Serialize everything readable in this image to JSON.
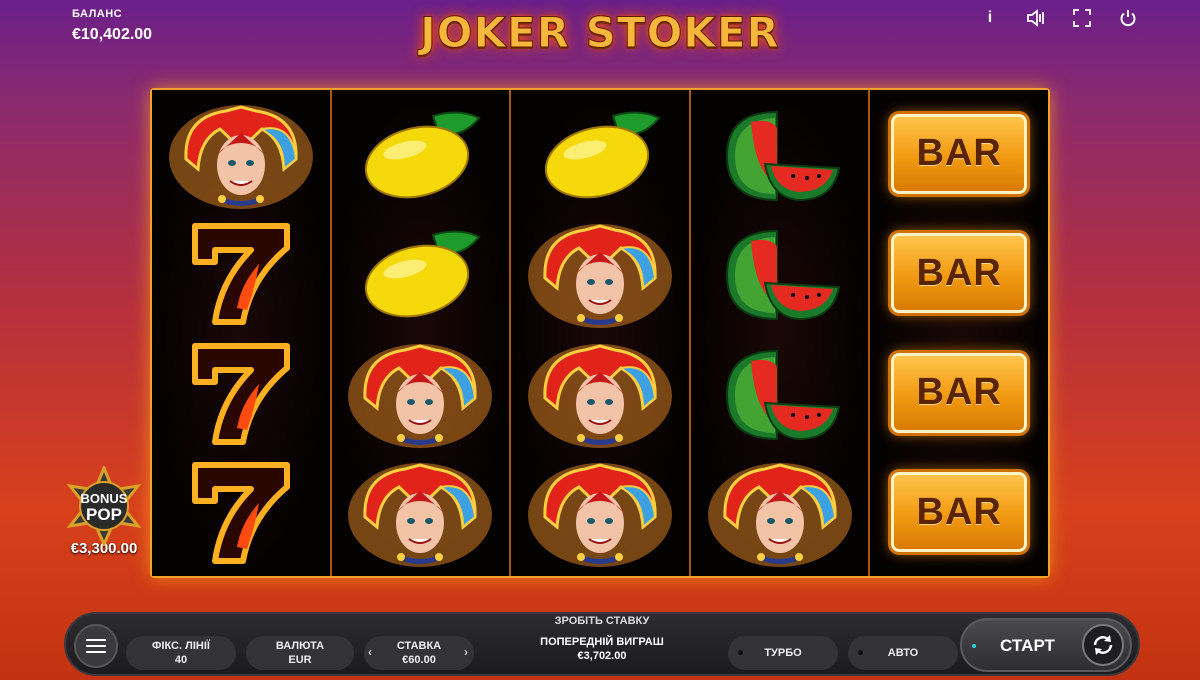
{
  "header": {
    "balance_label": "БАЛАНС",
    "balance_value": "€10,402.00",
    "logo_text": "JOKER STOKER",
    "icons": [
      "info-icon",
      "sound-icon",
      "fullscreen-icon",
      "power-icon"
    ]
  },
  "reels": [
    [
      "joker",
      "seven",
      "seven",
      "seven"
    ],
    [
      "lemon",
      "lemon",
      "joker",
      "joker"
    ],
    [
      "lemon",
      "joker",
      "joker",
      "joker"
    ],
    [
      "watermelon",
      "watermelon",
      "watermelon",
      "joker"
    ],
    [
      "bar",
      "bar",
      "bar",
      "bar"
    ]
  ],
  "symbols": {
    "bar_label": "BAR"
  },
  "bonus": {
    "line1": "BONUS",
    "line2": "POP",
    "value": "€3,300.00"
  },
  "controls": {
    "bet_prompt": "ЗРОБІТЬ СТАВКУ",
    "lines_label": "ФІКС. ЛІНІЇ",
    "lines_value": "40",
    "currency_label": "ВАЛЮТА",
    "currency_value": "EUR",
    "bet_label": "СТАВКА",
    "bet_value": "€60.00",
    "prev_win_label": "ПОПЕРЕДНІЙ ВИГРАШ",
    "prev_win_value": "€3,702.00",
    "turbo_label": "ТУРБО",
    "auto_label": "АВТО",
    "start_label": "СТАРТ",
    "bet_decrease": "‹",
    "bet_increase": "›"
  },
  "colors": {
    "accent": "#f4a02a",
    "bar_gold": "#f29a12",
    "start_dot": "#2bd0d0"
  }
}
